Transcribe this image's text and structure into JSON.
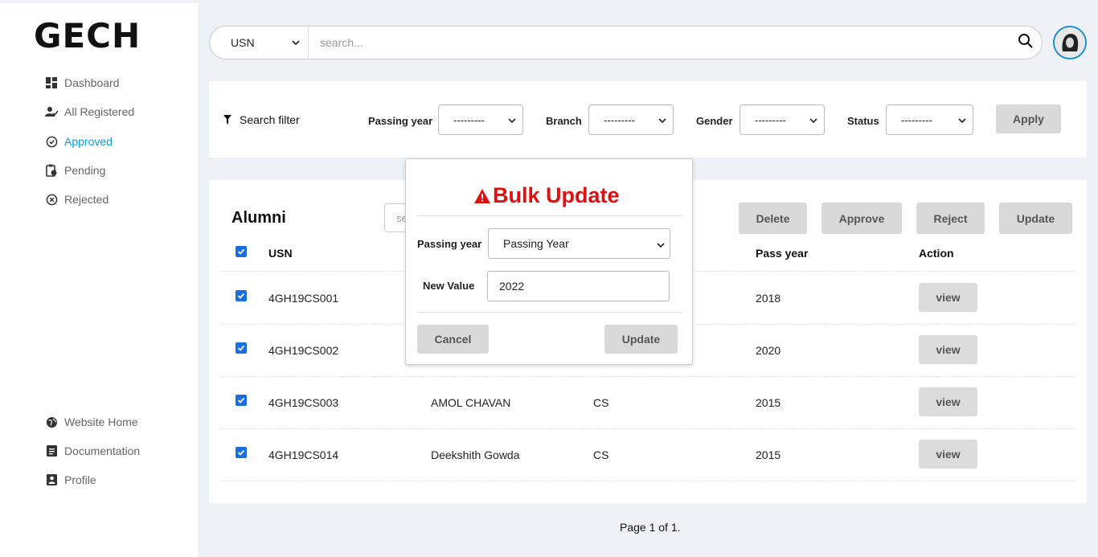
{
  "brand": {
    "logo": "GECH"
  },
  "sidebar": {
    "items": [
      {
        "label": "Dashboard",
        "icon": "dashboard-icon",
        "active": false
      },
      {
        "label": "All Registered",
        "icon": "user-check-icon",
        "active": false
      },
      {
        "label": "Approved",
        "icon": "check-circle-icon",
        "active": true
      },
      {
        "label": "Pending",
        "icon": "clipboard-clock-icon",
        "active": false
      },
      {
        "label": "Rejected",
        "icon": "x-circle-icon",
        "active": false
      }
    ],
    "bottom_items": [
      {
        "label": "Website Home",
        "icon": "globe-icon"
      },
      {
        "label": "Documentation",
        "icon": "document-icon"
      },
      {
        "label": "Profile",
        "icon": "profile-icon"
      }
    ],
    "active_color": "#0a9be0"
  },
  "search": {
    "field_select": "USN",
    "placeholder": "search..."
  },
  "filters": {
    "title": "Search filter",
    "passing_year_label": "Passing year",
    "passing_year_value": "---------",
    "branch_label": "Branch",
    "branch_value": "---------",
    "gender_label": "Gender",
    "gender_value": "---------",
    "status_label": "Status",
    "status_value": "---------",
    "apply_label": "Apply"
  },
  "table": {
    "title": "Alumni",
    "search_placeholder": "se",
    "actions": {
      "delete": "Delete",
      "approve": "Approve",
      "reject": "Reject",
      "update": "Update"
    },
    "columns": {
      "usn": "USN",
      "pass_year": "Pass year",
      "action": "Action"
    },
    "rows": [
      {
        "usn": "4GH19CS001",
        "name": "",
        "branch": "",
        "pass_year": "2018",
        "action": "view"
      },
      {
        "usn": "4GH19CS002",
        "name": "",
        "branch": "",
        "pass_year": "2020",
        "action": "view"
      },
      {
        "usn": "4GH19CS003",
        "name": "AMOL CHAVAN",
        "branch": "CS",
        "pass_year": "2015",
        "action": "view"
      },
      {
        "usn": "4GH19CS014",
        "name": "Deekshith Gowda",
        "branch": "CS",
        "pass_year": "2015",
        "action": "view"
      }
    ]
  },
  "pagination": {
    "text": "Page 1 of 1."
  },
  "modal": {
    "title": "Bulk Update",
    "field_label": "Passing year",
    "field_value": "Passing Year",
    "new_value_label": "New Value",
    "new_value": "2022",
    "cancel_label": "Cancel",
    "update_label": "Update",
    "title_color": "#e01010"
  }
}
